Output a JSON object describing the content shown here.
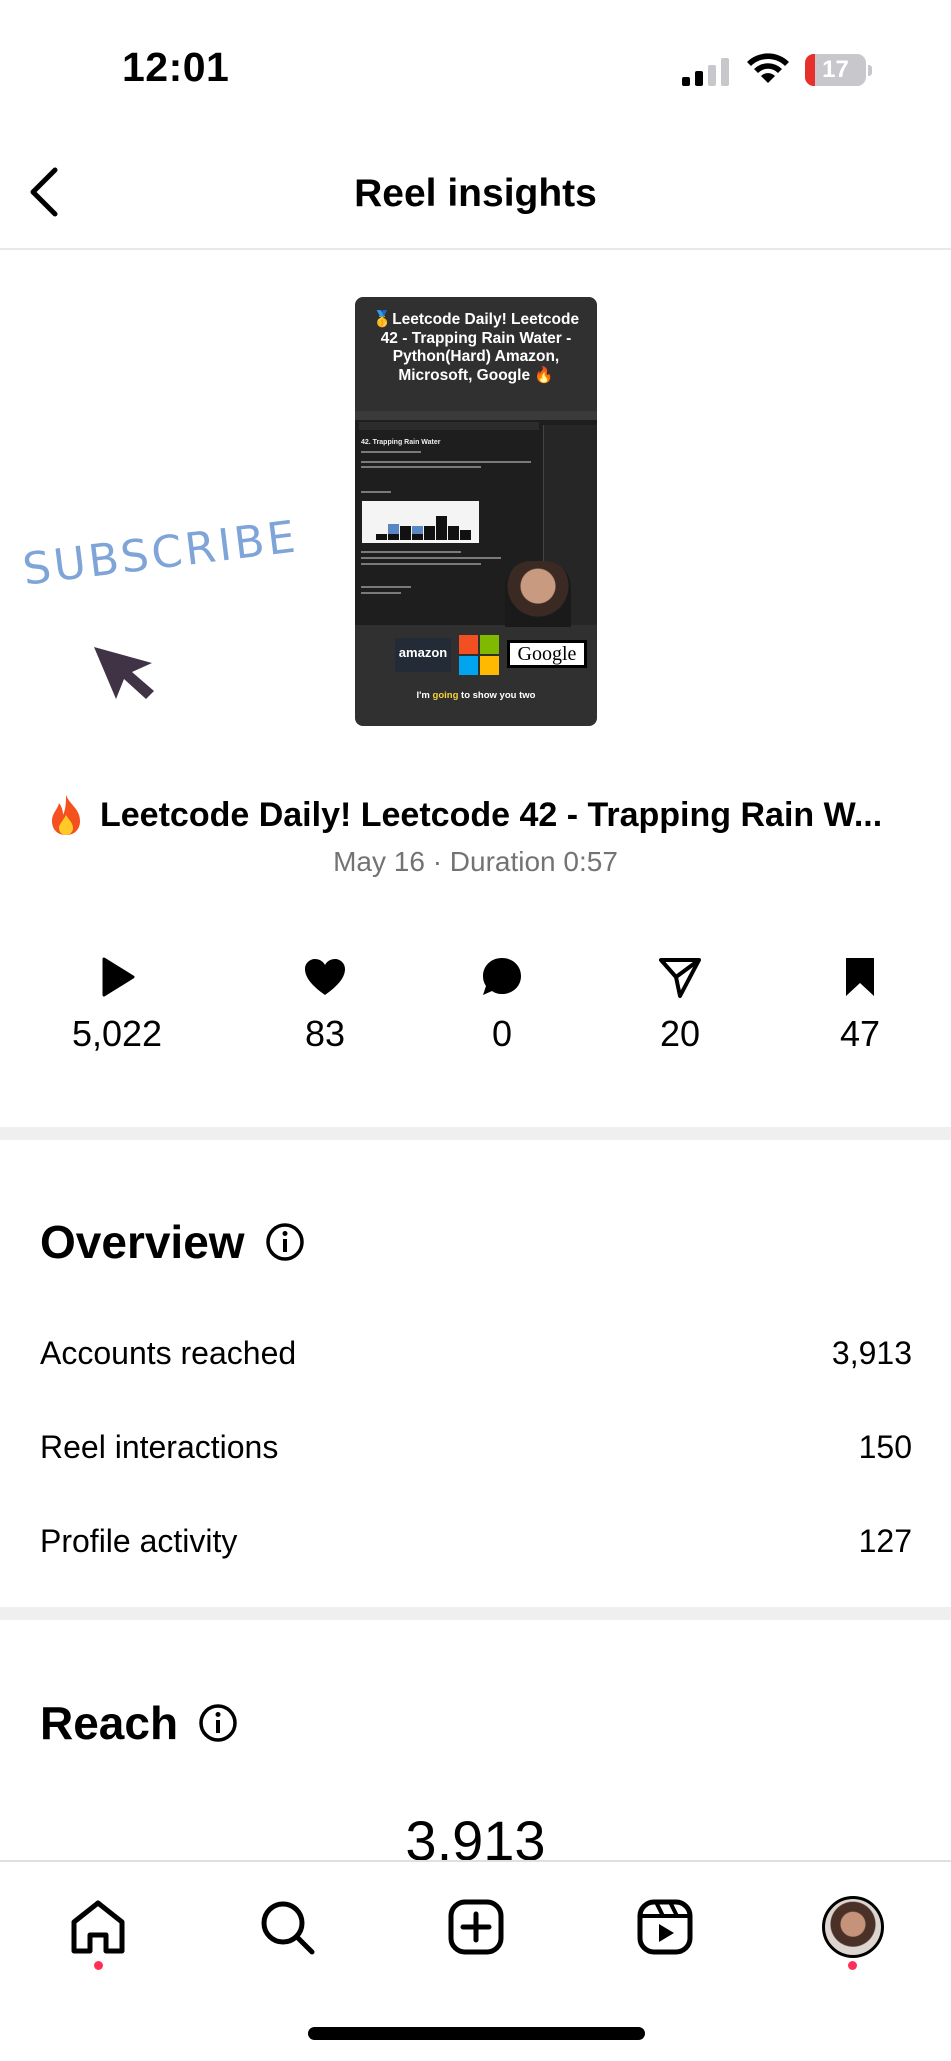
{
  "status_bar": {
    "time": "12:01",
    "battery": "17",
    "battery_level": 0.17,
    "battery_color": "#e5302b"
  },
  "header": {
    "title": "Reel insights",
    "back_icon": "chevron-left-icon"
  },
  "thumbnail": {
    "title": "🥇Leetcode Daily! Leetcode 42 - Trapping Rain Water - Python(Hard) Amazon, Microsoft, Google 🔥",
    "problem_title": "42. Trapping Rain Water",
    "logo_amazon": "amazon",
    "logo_google": "Google",
    "caption_before": "I'm ",
    "caption_highlight": "going",
    "caption_after": " to show you two"
  },
  "overlay": {
    "subscribe": "SUBSCRIBE",
    "subscribe_color": "#7fa4d8"
  },
  "reel": {
    "title": "Leetcode Daily! Leetcode 42 - Trapping Rain W...",
    "meta": "May 16 · Duration 0:57"
  },
  "stats": [
    {
      "icon": "play-icon",
      "value": "5,022"
    },
    {
      "icon": "heart-icon",
      "value": "83"
    },
    {
      "icon": "comment-icon",
      "value": "0"
    },
    {
      "icon": "share-icon",
      "value": "20"
    },
    {
      "icon": "bookmark-icon",
      "value": "47"
    }
  ],
  "overview": {
    "heading": "Overview",
    "rows": [
      {
        "label": "Accounts reached",
        "value": "3,913"
      },
      {
        "label": "Reel interactions",
        "value": "150"
      },
      {
        "label": "Profile activity",
        "value": "127"
      }
    ]
  },
  "reach": {
    "heading": "Reach",
    "value": "3,913"
  },
  "tab_bar": {
    "tabs": [
      "home-icon",
      "search-icon",
      "create-icon",
      "reels-icon",
      "profile-avatar"
    ],
    "notification_color": "#ff2f5a"
  }
}
